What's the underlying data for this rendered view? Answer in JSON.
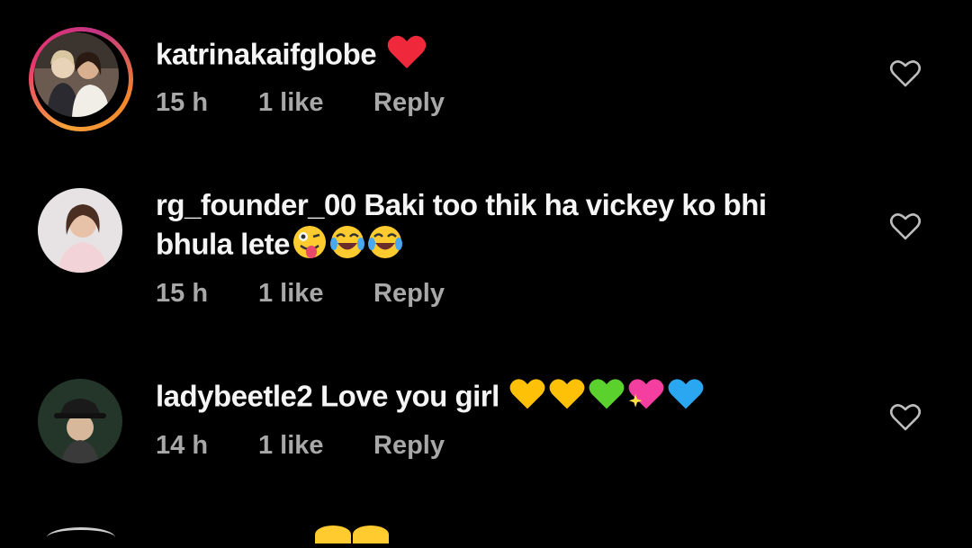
{
  "comments": [
    {
      "username": "katrinakaifglobe",
      "text": "",
      "emoji": [
        "red-heart"
      ],
      "time": "15 h",
      "likes": "1 like",
      "reply": "Reply"
    },
    {
      "username": "rg_founder_00",
      "text": "Baki too thik ha vickey ko bhi bhula lete",
      "emoji": [
        "winking-face-with-tongue",
        "tears-of-joy",
        "tears-of-joy"
      ],
      "time": "15 h",
      "likes": "1 like",
      "reply": "Reply"
    },
    {
      "username": "ladybeetle2",
      "text": "Love you girl",
      "emoji": [
        "yellow-heart",
        "yellow-heart",
        "green-heart",
        "sparkling-heart",
        "blue-heart"
      ],
      "time": "14 h",
      "likes": "1 like",
      "reply": "Reply"
    }
  ],
  "colors": {
    "background": "#000000",
    "text": "#f5f5f5",
    "meta": "#a8a8a8"
  }
}
